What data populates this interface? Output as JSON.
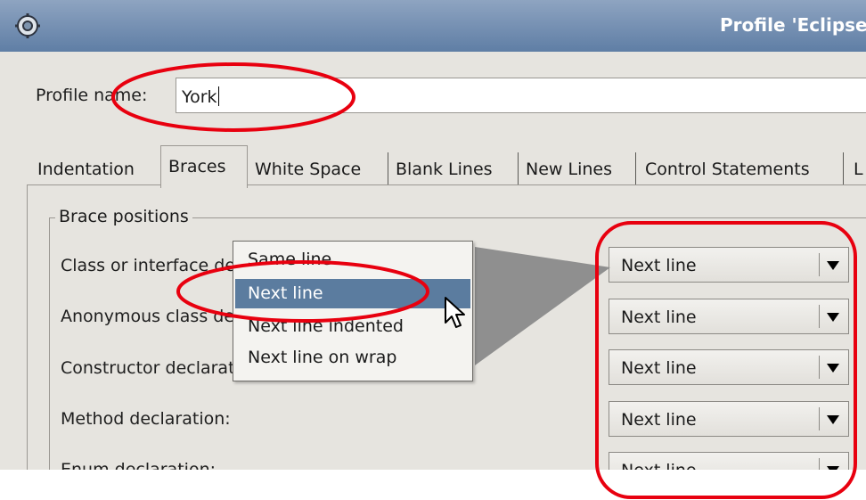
{
  "window": {
    "title": "Profile 'Eclipse",
    "app_icon": "gear-icon"
  },
  "profile": {
    "label": "Profile name:",
    "value": "York"
  },
  "tabs": [
    {
      "label": "Indentation",
      "selected": false
    },
    {
      "label": "Braces",
      "selected": true
    },
    {
      "label": "White Space",
      "selected": false
    },
    {
      "label": "Blank Lines",
      "selected": false
    },
    {
      "label": "New Lines",
      "selected": false
    },
    {
      "label": "Control Statements",
      "selected": false
    },
    {
      "label": "L",
      "selected": false
    }
  ],
  "group": {
    "title": "Brace positions"
  },
  "rows": [
    {
      "label": "Class or interface declaration:",
      "value": "Next line"
    },
    {
      "label": "Anonymous class declaration:",
      "value": "Next line"
    },
    {
      "label": "Constructor declaration:",
      "value": "Next line"
    },
    {
      "label": "Method declaration:",
      "value": "Next line"
    },
    {
      "label": "Enum declaration:",
      "value": "Next line"
    }
  ],
  "dropdown": {
    "options": [
      "Same line",
      "Next line",
      "Next line indented",
      "Next line on wrap"
    ],
    "highlighted": "Next line"
  },
  "annotation_color": "#e8000f",
  "selection_color": "#5b7c9f"
}
